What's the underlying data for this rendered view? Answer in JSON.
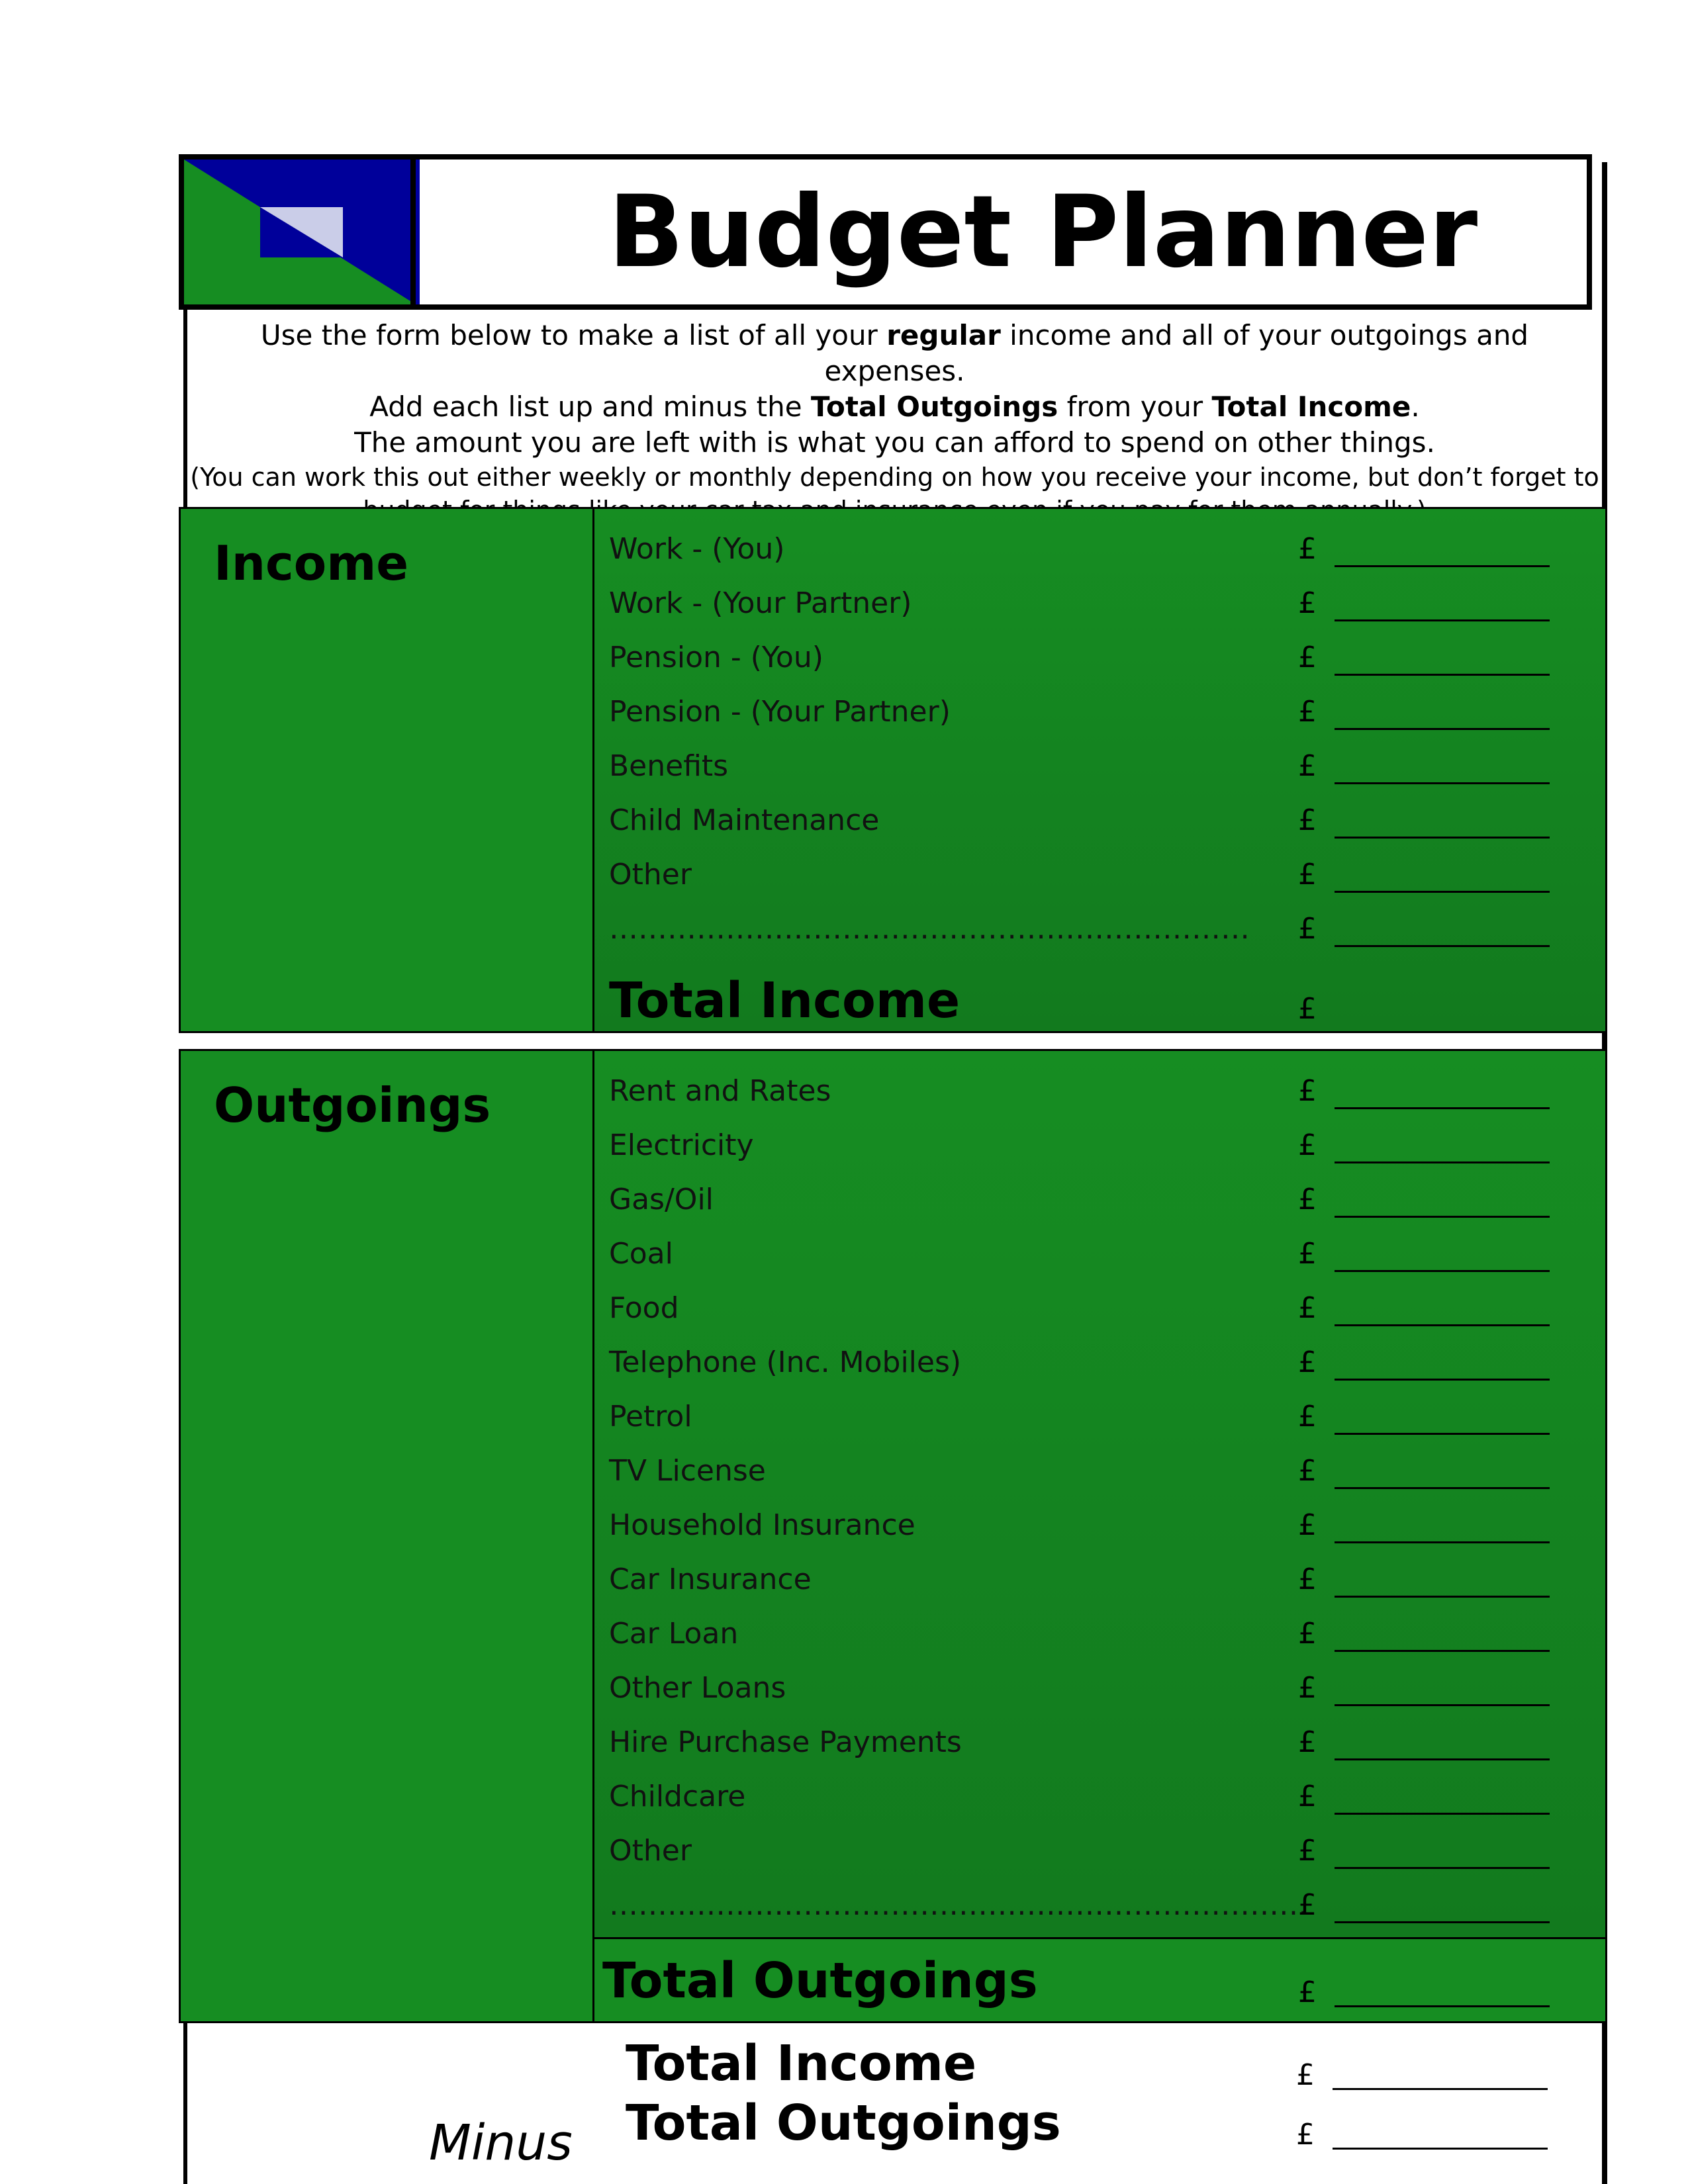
{
  "header": {
    "title": "Budget Planner",
    "logo_icon": "logo-icon"
  },
  "intro": {
    "line1_a": "Use the form below to make a list of all your ",
    "line1_b": "regular",
    "line1_c": " income and all of your outgoings and expenses.",
    "line2_a": "Add each list up and minus the ",
    "line2_b": "Total Outgoings",
    "line2_c": " from your ",
    "line2_d": "Total Income",
    "line2_e": ".",
    "line3": "The amount you are left with is what you can afford to spend on other things.",
    "line4": "(You can work this out either weekly or monthly depending on how you receive your income, but don’t forget to",
    "line5": "budget for things like your car tax and insurance even if you pay for them annually.)"
  },
  "currency": "£",
  "income": {
    "title": "Income",
    "items": [
      "Work - (You)",
      "Work - (Your Partner)",
      "Pension - (You)",
      "Pension - (Your Partner)",
      "Benefits",
      "Child Maintenance",
      "Other",
      "…………………………………………………………"
    ],
    "total_label": "Total Income"
  },
  "outgoings": {
    "title": "Outgoings",
    "items": [
      "Rent and Rates",
      "Electricity",
      "Gas/Oil",
      "Coal",
      "Food",
      "Telephone (Inc. Mobiles)",
      "Petrol",
      "TV License",
      "Household Insurance",
      "Car Insurance",
      "Car Loan",
      "Other Loans",
      "Hire Purchase Payments",
      "Childcare",
      "Other",
      "………………………………………………………………"
    ],
    "total_label": "Total Outgoings"
  },
  "summary": {
    "total_income": "Total Income",
    "minus": "Minus",
    "total_outgoings": "Total Outgoings"
  }
}
